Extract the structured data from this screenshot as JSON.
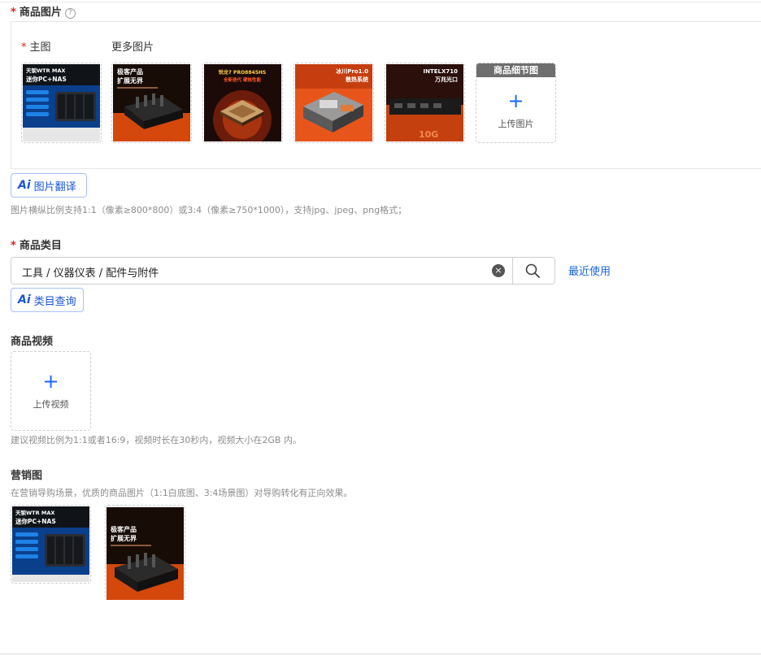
{
  "main_images": {
    "section_label": "商品图片",
    "help_icon": "?",
    "main_label": "主图",
    "more_label": "更多图片",
    "thumb1": {
      "line1": "天钡WTR MAX",
      "line2": "迷你PC+NAS"
    },
    "thumb2": {
      "line1": "极客产品",
      "line2": "扩展无界"
    },
    "thumb3": {
      "line1": "锐龙7 PRO8845HS",
      "line2": "全新迭代 硬核性能"
    },
    "thumb4": {
      "line1": "冰川Pro1.0",
      "line2": "散热系统"
    },
    "thumb5": {
      "line1": "INTELX710",
      "line2": "万兆光口",
      "tag": "10G"
    },
    "detail_header": "商品细节图",
    "upload_plus": "+",
    "upload_text": "上传图片"
  },
  "image_translate_button": {
    "ai": "Ai",
    "label": "图片翻译"
  },
  "image_hint": "图片横纵比例支持1:1（像素≥800*800）或3:4（像素≥750*1000），支持jpg、jpeg、png格式；",
  "category": {
    "label": "商品类目",
    "value": "工具 / 仪器仪表 / 配件与附件",
    "clear_icon": "×",
    "recent_link": "最近使用",
    "ai_button": {
      "ai": "Ai",
      "label": "类目查询"
    }
  },
  "video": {
    "label": "商品视频",
    "upload_plus": "+",
    "upload_text": "上传视频",
    "hint": "建议视频比例为1:1或者16:9，视频时长在30秒内，视频大小在2GB 内。"
  },
  "marketing": {
    "label": "营销图",
    "hint": "在营销导购场景，优质的商品图片（1:1白底图、3:4场景图）对导购转化有正向效果。",
    "thumb1": {
      "line1": "天钡WTR MAX",
      "line2": "迷你PC+NAS"
    },
    "thumb2": {
      "line1": "极客产品",
      "line2": "扩展无界"
    }
  },
  "colors": {
    "accent": "#1a66ff",
    "required": "#e02020",
    "link": "#1a66d6"
  }
}
